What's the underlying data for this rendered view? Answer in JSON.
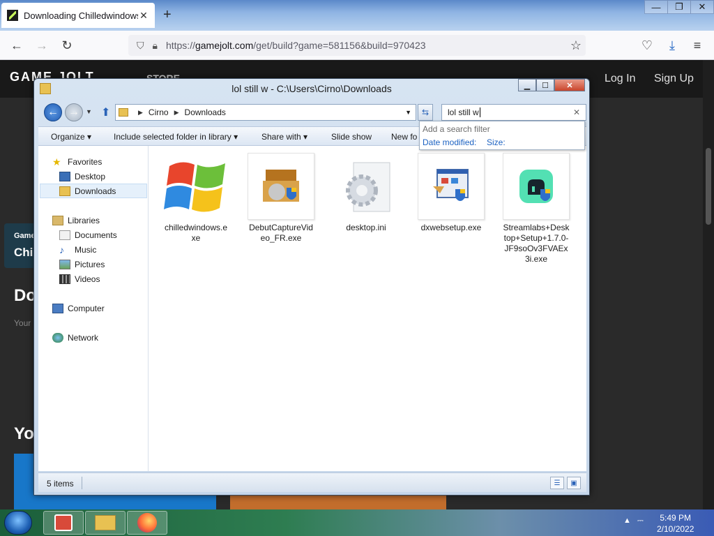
{
  "browser": {
    "tab_title": "Downloading Chilledwindows.e",
    "tab_close": "✕",
    "new_tab": "+",
    "url_prefix": "https://",
    "url_host": "gamejolt.com",
    "url_path": "/get/build?game=581156&build=970423",
    "controls": {
      "minimize": "—",
      "restore": "❐",
      "close": "✕"
    }
  },
  "page": {
    "logo": "GAME JOLT",
    "store": "STORE",
    "login": "Log In",
    "signup": "Sign Up",
    "snippets": {
      "game": "Game",
      "chi": "Chi",
      "do": "Do",
      "your": "Your",
      "yo": "Yo"
    }
  },
  "explorer": {
    "title": "lol still w - C:\\Users\\Cirno\\Downloads",
    "buttons": {
      "minimize": "▁",
      "maximize": "☐",
      "close": "✕"
    },
    "breadcrumb": [
      "Cirno",
      "Downloads"
    ],
    "search_value": "lol still w",
    "search_dropdown": {
      "hint": "Add a search filter",
      "filter1": "Date modified:",
      "filter2": "Size:"
    },
    "toolbar": {
      "organize": "Organize ▾",
      "include": "Include selected folder in library ▾",
      "share": "Share with ▾",
      "slideshow": "Slide show",
      "newfolder": "New fo"
    },
    "nav": {
      "favorites": "Favorites",
      "desktop": "Desktop",
      "downloads": "Downloads",
      "libraries": "Libraries",
      "documents": "Documents",
      "music": "Music",
      "pictures": "Pictures",
      "videos": "Videos",
      "computer": "Computer",
      "network": "Network"
    },
    "files": [
      {
        "name": "chilledwindows.exe",
        "icon": "windows-logo-icon"
      },
      {
        "name": "DebutCaptureVideo_FR.exe",
        "icon": "installer-box-icon"
      },
      {
        "name": "desktop.ini",
        "icon": "gear-settings-file-icon"
      },
      {
        "name": "dxwebsetup.exe",
        "icon": "setup-window-icon"
      },
      {
        "name": "Streamlabs+Desktop+Setup+1.7.0-JF9soOv3FVAEx3i.exe",
        "icon": "streamlabs-icon"
      }
    ],
    "status": "5 items"
  },
  "taskbar": {
    "time": "5:49 PM",
    "date": "2/10/2022"
  }
}
